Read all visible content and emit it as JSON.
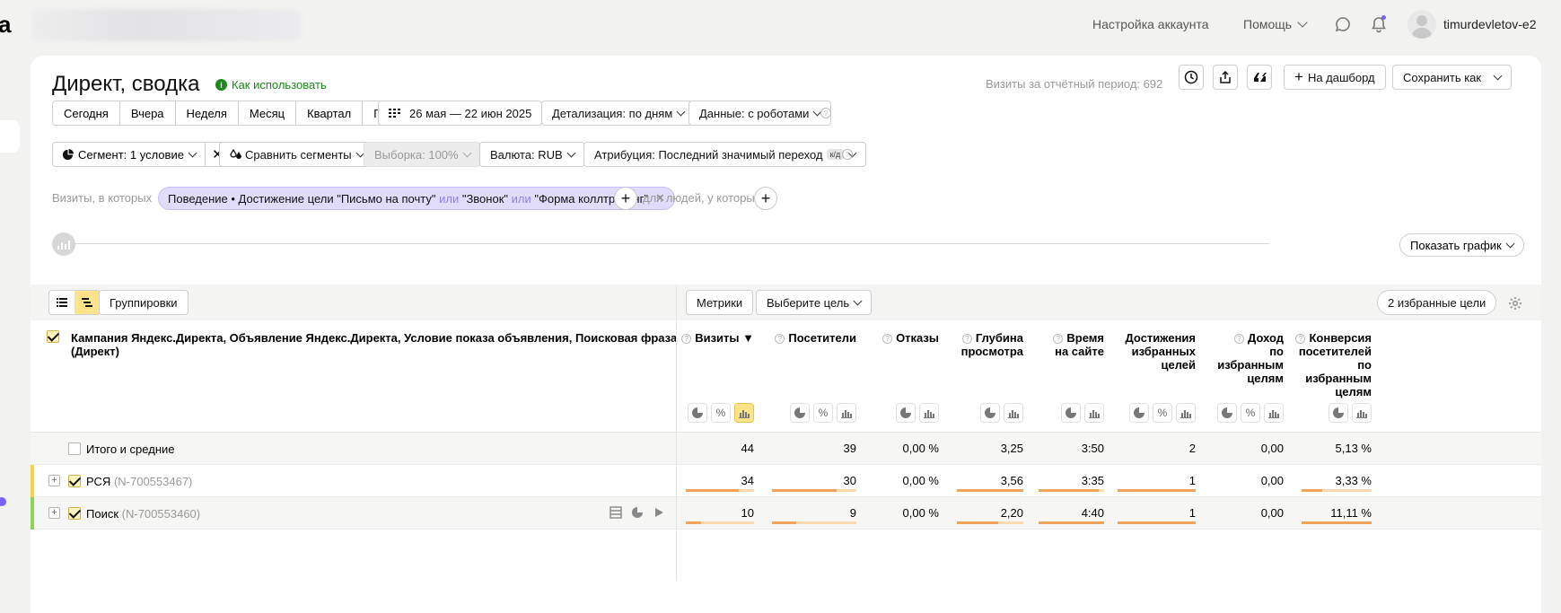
{
  "header": {
    "logo_fragment": "a",
    "account_settings": "Настройка аккаунта",
    "help": "Помощь",
    "username": "timurdevletov-e2"
  },
  "page": {
    "title": "Директ, сводка",
    "how_to_use": "Как использовать",
    "visits_period": "Визиты за отчётный период: 692",
    "to_dashboard": "На дашборд",
    "save_as": "Сохранить как"
  },
  "periods": [
    "Сегодня",
    "Вчера",
    "Неделя",
    "Месяц",
    "Квартал",
    "Год"
  ],
  "controls": {
    "date_range": "26 мая — 22 июн 2025",
    "detail": "Детализация: по дням",
    "data": "Данные: с роботами",
    "segment": "Сегмент: 1 условие",
    "compare": "Сравнить сегменты",
    "sample": "Выборка: 100%",
    "currency": "Валюта: RUB",
    "attribution": "Атрибуция: Последний значимый переход",
    "attribution_badge": "к/д"
  },
  "filter": {
    "visits_label": "Визиты, в которых",
    "chip_prefix": "Поведение • Достижение цели \"Письмо на почту\"",
    "or": "или",
    "chip_mid": "\"Звонок\"",
    "chip_end": "\"Форма коллтрекинг\"",
    "people_label": "для людей, у которых"
  },
  "chart": {
    "show_graph": "Показать график"
  },
  "table": {
    "groupings": "Группировки",
    "metrics": "Метрики",
    "choose_goal": "Выберите цель",
    "fav_goals": "2 избранные цели",
    "dims_header": "Кампания Яндекс.Директа, Объявление Яндекс.Директа, Условие показа объявления, Поисковая фраза (Директ)",
    "columns": [
      {
        "lines": [
          "Визиты ▼"
        ]
      },
      {
        "lines": [
          "Посетители"
        ]
      },
      {
        "lines": [
          "Отказы"
        ]
      },
      {
        "lines": [
          "Глубина",
          "просмотра"
        ]
      },
      {
        "lines": [
          "Время",
          "на сайте"
        ]
      },
      {
        "lines": [
          "Достижения",
          "избранных",
          "целей"
        ]
      },
      {
        "lines": [
          "Доход",
          "по",
          "избранным",
          "целям"
        ]
      },
      {
        "lines": [
          "Конверсия",
          "посетителей",
          "по",
          "избранным",
          "целям"
        ]
      }
    ],
    "total": {
      "name": "Итого и средние",
      "values": [
        "44",
        "39",
        "0,00 %",
        "3,25",
        "3:50",
        "2",
        "0,00",
        "5,13 %"
      ]
    },
    "rows": [
      {
        "name": "РСЯ",
        "id": "(N-700553467)",
        "values": [
          "34",
          "30",
          "0,00 %",
          "3,56",
          "3:35",
          "1",
          "0,00",
          "3,33 %"
        ],
        "fractions": [
          0.77,
          0.77,
          0,
          1.0,
          0.92,
          1.0,
          0,
          0.3
        ],
        "color": "#f5d44a"
      },
      {
        "name": "Поиск",
        "id": "(N-700553460)",
        "values": [
          "10",
          "9",
          "0,00 %",
          "2,20",
          "4:40",
          "1",
          "0,00",
          "11,11 %"
        ],
        "fractions": [
          0.23,
          0.29,
          0,
          0.62,
          1.0,
          1.0,
          0,
          1.0
        ],
        "color": "#8fd45a"
      }
    ]
  }
}
